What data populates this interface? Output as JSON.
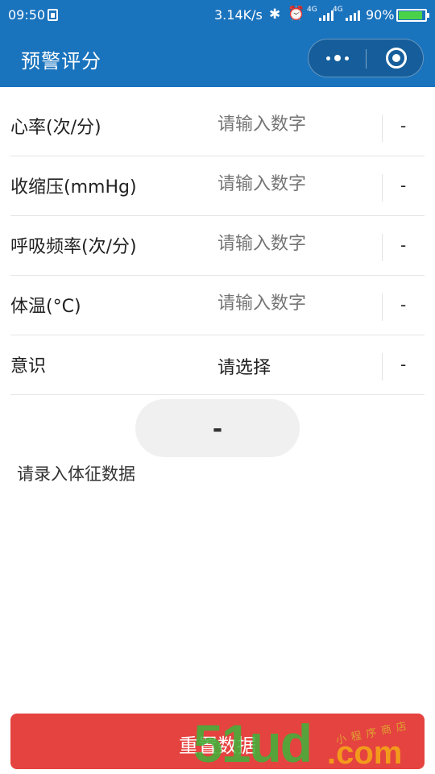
{
  "status_bar": {
    "time": "09:50",
    "speed": "3.14K/s",
    "net1": "4G",
    "net2": "4G",
    "battery_pct": "90%",
    "battery_level": 0.9,
    "battery_color": "#4bd24b"
  },
  "nav": {
    "title": "预警评分",
    "more_icon": "more-dots-icon",
    "close_icon": "target-circle-icon",
    "bar_color": "#1a73bd"
  },
  "form": {
    "rows": [
      {
        "label": "心率(次/分)",
        "placeholder": "请输入数字",
        "score": "-"
      },
      {
        "label": "收缩压(mmHg)",
        "placeholder": "请输入数字",
        "score": "-"
      },
      {
        "label": "呼吸频率(次/分)",
        "placeholder": "请输入数字",
        "score": "-"
      },
      {
        "label": "体温(°C)",
        "placeholder": "请输入数字",
        "score": "-"
      },
      {
        "label": "意识",
        "select_value": "请选择",
        "score": "-"
      }
    ]
  },
  "result": {
    "total": "-",
    "hint": "请录入体征数据"
  },
  "footer": {
    "reset_label": "重置数据",
    "reset_color": "#e5433f"
  },
  "watermark": {
    "big": "51ud",
    "com": ".com",
    "small": "小程序商店"
  }
}
